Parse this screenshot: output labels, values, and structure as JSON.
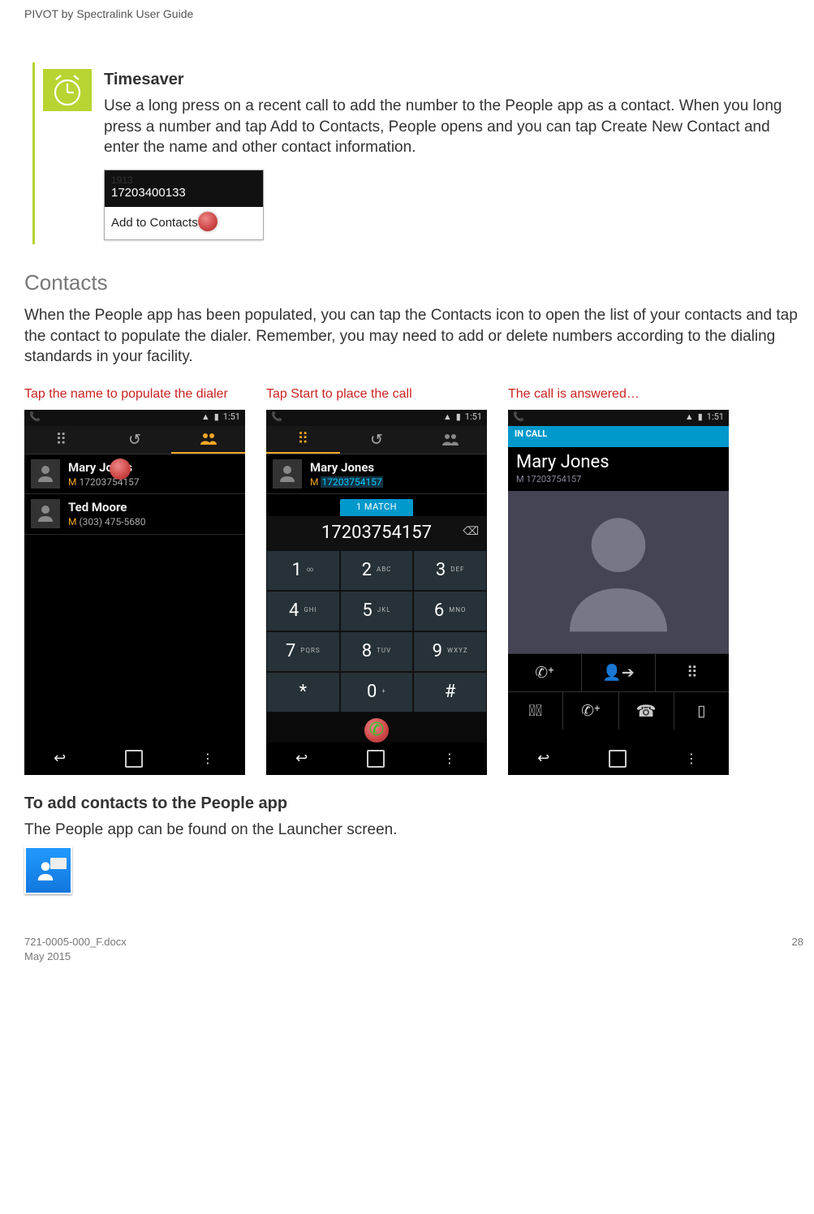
{
  "header": "PIVOT by Spectralink User Guide",
  "callout": {
    "title": "Timesaver",
    "body": "Use a long press on a recent call to add the number to the People app as a contact. When you long press a number and tap Add to Contacts, People opens and you can tap Create New Contact and enter the name and other contact information.",
    "popup_number": "17203400133",
    "popup_action": "Add to Contacts"
  },
  "section_title": "Contacts",
  "section_body": "When the People app has been populated, you can tap the Contacts icon to open the list of your contacts and tap the contact to populate the dialer. Remember, you may need to add or delete numbers according to the dialing standards in your facility.",
  "captions": {
    "c1": "Tap the name to populate the dialer",
    "c2": "Tap Start to place the call",
    "c3": "The call is answered…"
  },
  "status_time": "1:51",
  "contacts_list": {
    "c1": {
      "name": "Mary Jones",
      "prefix": "M",
      "num": "17203754157"
    },
    "c2": {
      "name": "Ted Moore",
      "prefix": "M",
      "num": "(303) 475-5680"
    }
  },
  "dialer": {
    "match_label": "1 MATCH",
    "typed": "17203754157",
    "keys": {
      "k1": "1",
      "k1s": "",
      "k2": "2",
      "k2s": "ABC",
      "k3": "3",
      "k3s": "DEF",
      "k4": "4",
      "k4s": "GHI",
      "k5": "5",
      "k5s": "JKL",
      "k6": "6",
      "k6s": "MNO",
      "k7": "7",
      "k7s": "PQRS",
      "k8": "8",
      "k8s": "TUV",
      "k9": "9",
      "k9s": "WXYZ",
      "kstar": "*",
      "k0": "0",
      "k0s": "+",
      "khash": "#"
    }
  },
  "incall": {
    "banner": "IN CALL",
    "name": "Mary Jones",
    "num": "M 17203754157"
  },
  "subhead": "To add contacts to the People app",
  "subbody": "The People app can be found on the Launcher screen.",
  "footer": {
    "doc": "721-0005-000_F.docx",
    "date": "May 2015",
    "page": "28"
  }
}
